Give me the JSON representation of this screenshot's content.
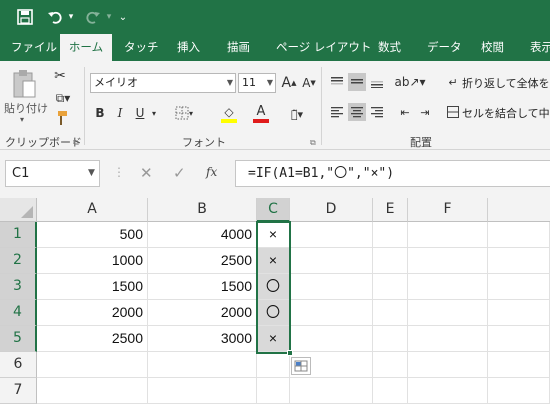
{
  "quick_access": {
    "save_icon": "save-icon",
    "undo_icon": "undo-icon",
    "redo_icon": "redo-icon",
    "customize_icon": "customize-icon"
  },
  "tabs": [
    "ファイル",
    "ホーム",
    "タッチ",
    "挿入",
    "描画",
    "ページ レイアウト",
    "数式",
    "データ",
    "校閲",
    "表示"
  ],
  "active_tab": "ホーム",
  "ribbon": {
    "paste_label": "貼り付け",
    "clipboard_group": "クリップボード",
    "font_name": "メイリオ",
    "font_size": "11",
    "font_group": "フォント",
    "bold": "B",
    "italic": "I",
    "underline": "U",
    "font_color_letter": "A",
    "grow_font": "A",
    "shrink_font": "A",
    "wrap_text": "折り返して全体を表",
    "merge_center": "セルを結合して中央",
    "alignment_group": "配置"
  },
  "formula_bar": {
    "name_box": "C1",
    "fx": "fx",
    "formula": "=IF(A1=B1,\"〇\",\"×\")"
  },
  "columns": [
    "A",
    "B",
    "C",
    "D",
    "E",
    "F"
  ],
  "selected_column": "C",
  "rows": [
    {
      "num": "1",
      "A": "500",
      "B": "4000",
      "C": "×"
    },
    {
      "num": "2",
      "A": "1000",
      "B": "2500",
      "C": "×"
    },
    {
      "num": "3",
      "A": "1500",
      "B": "1500",
      "C": "〇"
    },
    {
      "num": "4",
      "A": "2000",
      "B": "2000",
      "C": "〇"
    },
    {
      "num": "5",
      "A": "2500",
      "B": "3000",
      "C": "×"
    },
    {
      "num": "6",
      "A": "",
      "B": "",
      "C": ""
    },
    {
      "num": "7",
      "A": "",
      "B": "",
      "C": ""
    }
  ],
  "colors": {
    "accent": "#217346",
    "selection": "#d9d9d9",
    "ribbon_bg": "#f3f3f3"
  }
}
